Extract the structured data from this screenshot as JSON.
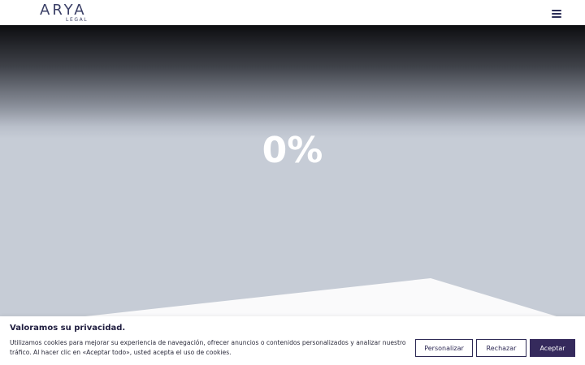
{
  "header": {
    "logo_text": "ARYA",
    "logo_subtext": "LEGAL",
    "menu_icon": "hamburger-menu-icon"
  },
  "hero": {
    "loading_percent_text": "0%",
    "loading_percent": 0
  },
  "cookie_banner": {
    "title": "Valoramos su privacidad.",
    "text": "Utilizamos cookies para mejorar su experiencia de navegación, ofrecer anuncios o contenidos personalizados y analizar nuestro tráfico. Al hacer clic en «Aceptar todo», usted acepta el uso de cookies.",
    "customize_label": "Personalizar",
    "reject_label": "Rechazar",
    "accept_label": "Aceptar"
  },
  "colors": {
    "brand": "#3a3f66",
    "accent_button": "#352a5c",
    "hero_background": "#c6ccd6",
    "page_background": "#ffffff"
  }
}
